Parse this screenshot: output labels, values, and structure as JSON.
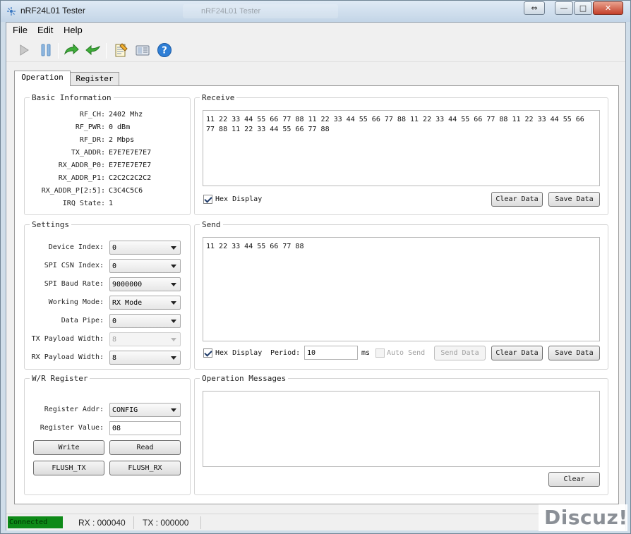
{
  "window": {
    "title": "nRF24L01 Tester",
    "ghost_title": "nRF24L01 Tester",
    "controls": {
      "restore": "⇔",
      "minimize": "—",
      "maximize": "□",
      "close": "✕"
    }
  },
  "menu": {
    "items": [
      "File",
      "Edit",
      "Help"
    ]
  },
  "toolbar": {
    "icons": [
      "play-icon",
      "pause-icon",
      "forward-arrow-icon",
      "back-arrow-icon",
      "notepad-icon",
      "calculator-icon",
      "help-icon"
    ]
  },
  "tabs": [
    {
      "label": "Operation",
      "active": true
    },
    {
      "label": "Register",
      "active": false
    }
  ],
  "basic_info": {
    "title": "Basic Information",
    "rows": [
      {
        "label": "RF_CH:",
        "value": "2402 Mhz"
      },
      {
        "label": "RF_PWR:",
        "value": "0 dBm"
      },
      {
        "label": "RF_DR:",
        "value": "2 Mbps"
      },
      {
        "label": "TX_ADDR:",
        "value": "E7E7E7E7E7"
      },
      {
        "label": "RX_ADDR_P0:",
        "value": "E7E7E7E7E7"
      },
      {
        "label": "RX_ADDR_P1:",
        "value": "C2C2C2C2C2"
      },
      {
        "label": "RX_ADDR_P[2:5]:",
        "value": "C3C4C5C6"
      },
      {
        "label": "IRQ State:",
        "value": "1"
      }
    ]
  },
  "settings": {
    "title": "Settings",
    "rows": [
      {
        "label": "Device Index:",
        "value": "0",
        "disabled": false
      },
      {
        "label": "SPI CSN Index:",
        "value": "0",
        "disabled": false
      },
      {
        "label": "SPI Baud Rate:",
        "value": "9000000",
        "disabled": false
      },
      {
        "label": "Working Mode:",
        "value": "RX Mode",
        "disabled": false
      },
      {
        "label": "Data Pipe:",
        "value": "0",
        "disabled": false
      },
      {
        "label": "TX Payload Width:",
        "value": "8",
        "disabled": true
      },
      {
        "label": "RX Payload Width:",
        "value": "8",
        "disabled": false
      }
    ]
  },
  "wr_register": {
    "title": "W/R Register",
    "addr_label": "Register Addr:",
    "addr_value": "CONFIG",
    "value_label": "Register Value:",
    "value_value": "08",
    "write_label": "Write",
    "read_label": "Read",
    "flush_tx_label": "FLUSH_TX",
    "flush_rx_label": "FLUSH_RX"
  },
  "receive": {
    "title": "Receive",
    "data": "11 22 33 44 55 66 77 88 11 22 33 44 55 66 77 88 11 22 33 44 55 66 77 88 11 22 33 44 55 66 77 88 11 22 33 44 55 66 77 88",
    "hex_display_label": "Hex Display",
    "hex_display_checked": true,
    "clear_label": "Clear Data",
    "save_label": "Save Data"
  },
  "send": {
    "title": "Send",
    "data": "11 22 33 44 55 66 77 88",
    "hex_display_label": "Hex Display",
    "hex_display_checked": true,
    "period_label": "Period:",
    "period_value": "10",
    "period_unit": "ms",
    "auto_send_label": "Auto Send",
    "auto_send_checked": false,
    "send_label": "Send Data",
    "clear_label": "Clear Data",
    "save_label": "Save Data"
  },
  "messages": {
    "title": "Operation Messages",
    "text": "",
    "clear_label": "Clear"
  },
  "status": {
    "connected": "Connected",
    "rx": "RX : 000040",
    "tx": "TX : 000000"
  },
  "watermark": "Discuz!"
}
